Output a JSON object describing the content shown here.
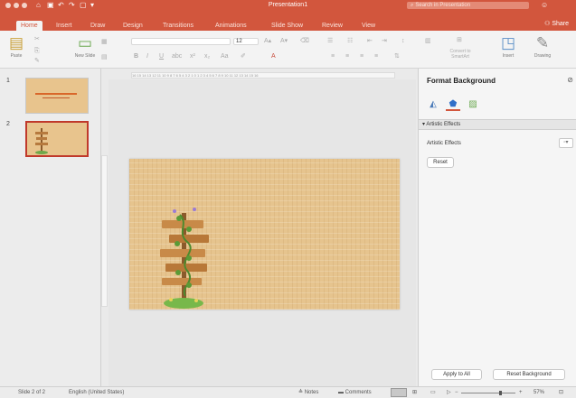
{
  "window": {
    "title": "Presentation1",
    "search_placeholder": "Search in Presentation",
    "share_label": "Share"
  },
  "tabs": [
    "Home",
    "Insert",
    "Draw",
    "Design",
    "Transitions",
    "Animations",
    "Slide Show",
    "Review",
    "View"
  ],
  "ribbon": {
    "paste_label": "Paste",
    "new_slide_label": "New Slide",
    "convert_smartart_label": "Convert to SmartArt",
    "insert_label": "Insert",
    "drawing_label": "Drawing",
    "font_size": "12"
  },
  "slides": [
    {
      "number": "1"
    },
    {
      "number": "2"
    }
  ],
  "format_pane": {
    "title": "Format Background",
    "section": "Artistic Effects",
    "field_label": "Artistic Effects",
    "reset_label": "Reset",
    "apply_all_label": "Apply to All",
    "reset_background_label": "Reset Background"
  },
  "status": {
    "slide_info": "Slide 2 of 2",
    "language": "English (United States)",
    "notes_label": "Notes",
    "comments_label": "Comments",
    "zoom": "57%"
  },
  "colors": {
    "accent": "#d2563d",
    "slide_bg": "#e6c48e",
    "selection": "#c0392b"
  }
}
